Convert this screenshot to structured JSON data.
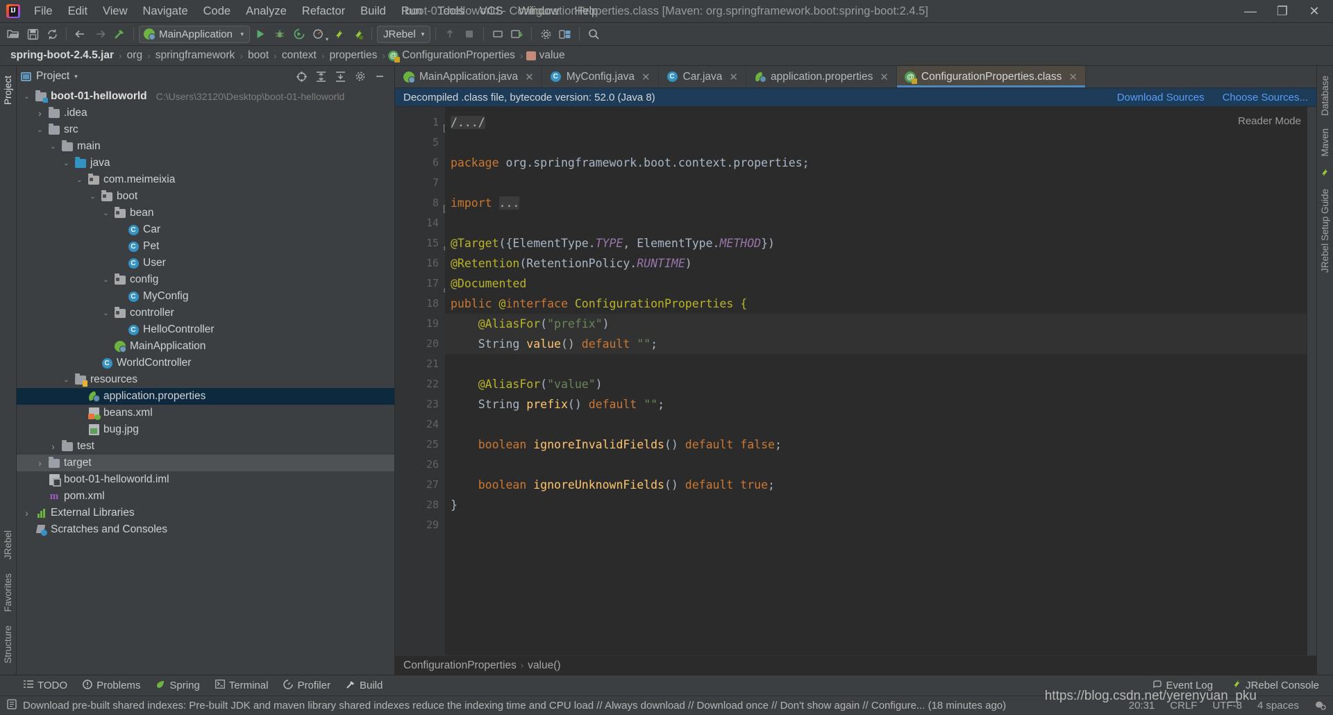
{
  "window": {
    "title": "boot-01-helloworld - ConfigurationProperties.class [Maven: org.springframework.boot:spring-boot:2.4.5]",
    "minimize": "—",
    "maximize": "❐",
    "close": "✕"
  },
  "menu": [
    "File",
    "Edit",
    "View",
    "Navigate",
    "Code",
    "Analyze",
    "Refactor",
    "Build",
    "Run",
    "Tools",
    "VCS",
    "Window",
    "Help"
  ],
  "toolbar": {
    "run_config": "MainApplication",
    "jrebel_selector": "JRebel",
    "caret": "▾"
  },
  "breadcrumb": {
    "items": [
      "spring-boot-2.4.5.jar",
      "org",
      "springframework",
      "boot",
      "context",
      "properties",
      "ConfigurationProperties",
      "value"
    ],
    "separator": "›"
  },
  "project_panel": {
    "title": "Project",
    "caret": "▾",
    "tree": [
      {
        "label": "boot-01-helloworld",
        "sub": "C:\\Users\\32120\\Desktop\\boot-01-helloworld",
        "depth": 0,
        "arrow": "v",
        "icon": "module-folder",
        "bold": true
      },
      {
        "label": ".idea",
        "sub": "",
        "depth": 1,
        "arrow": ">",
        "icon": "folder"
      },
      {
        "label": "src",
        "sub": "",
        "depth": 1,
        "arrow": "v",
        "icon": "folder"
      },
      {
        "label": "main",
        "sub": "",
        "depth": 2,
        "arrow": "v",
        "icon": "folder"
      },
      {
        "label": "java",
        "sub": "",
        "depth": 3,
        "arrow": "v",
        "icon": "source-folder"
      },
      {
        "label": "com.meimeixia",
        "sub": "",
        "depth": 4,
        "arrow": "v",
        "icon": "package"
      },
      {
        "label": "boot",
        "sub": "",
        "depth": 5,
        "arrow": "v",
        "icon": "package"
      },
      {
        "label": "bean",
        "sub": "",
        "depth": 6,
        "arrow": "v",
        "icon": "package"
      },
      {
        "label": "Car",
        "sub": "",
        "depth": 7,
        "arrow": "",
        "icon": "class"
      },
      {
        "label": "Pet",
        "sub": "",
        "depth": 7,
        "arrow": "",
        "icon": "class"
      },
      {
        "label": "User",
        "sub": "",
        "depth": 7,
        "arrow": "",
        "icon": "class"
      },
      {
        "label": "config",
        "sub": "",
        "depth": 6,
        "arrow": "v",
        "icon": "package"
      },
      {
        "label": "MyConfig",
        "sub": "",
        "depth": 7,
        "arrow": "",
        "icon": "class"
      },
      {
        "label": "controller",
        "sub": "",
        "depth": 6,
        "arrow": "v",
        "icon": "package"
      },
      {
        "label": "HelloController",
        "sub": "",
        "depth": 7,
        "arrow": "",
        "icon": "class"
      },
      {
        "label": "MainApplication",
        "sub": "",
        "depth": 6,
        "arrow": "",
        "icon": "springboot-class"
      },
      {
        "label": "WorldController",
        "sub": "",
        "depth": 5,
        "arrow": "",
        "icon": "class"
      },
      {
        "label": "resources",
        "sub": "",
        "depth": 3,
        "arrow": "v",
        "icon": "resources-folder"
      },
      {
        "label": "application.properties",
        "sub": "",
        "depth": 4,
        "arrow": "",
        "icon": "spring-properties",
        "selected": true
      },
      {
        "label": "beans.xml",
        "sub": "",
        "depth": 4,
        "arrow": "",
        "icon": "spring-xml"
      },
      {
        "label": "bug.jpg",
        "sub": "",
        "depth": 4,
        "arrow": "",
        "icon": "image"
      },
      {
        "label": "test",
        "sub": "",
        "depth": 2,
        "arrow": ">",
        "icon": "folder"
      },
      {
        "label": "target",
        "sub": "",
        "depth": 1,
        "arrow": ">",
        "icon": "folder",
        "hovered": true
      },
      {
        "label": "boot-01-helloworld.iml",
        "sub": "",
        "depth": 1,
        "arrow": "",
        "icon": "iml"
      },
      {
        "label": "pom.xml",
        "sub": "",
        "depth": 1,
        "arrow": "",
        "icon": "maven"
      },
      {
        "label": "External Libraries",
        "sub": "",
        "depth": 0,
        "arrow": ">",
        "icon": "libraries"
      },
      {
        "label": "Scratches and Consoles",
        "sub": "",
        "depth": 0,
        "arrow": "",
        "icon": "scratches"
      }
    ]
  },
  "left_strip": {
    "tabs": [
      "Project",
      "Structure",
      "Favorites",
      "JRebel"
    ]
  },
  "right_strip": {
    "tabs": [
      "Database",
      "Maven",
      "JRebel Setup Guide"
    ]
  },
  "editor": {
    "tabs": [
      {
        "label": "MainApplication.java",
        "icon": "springboot-class",
        "close": "✕",
        "active": false
      },
      {
        "label": "MyConfig.java",
        "icon": "class",
        "close": "✕",
        "active": false
      },
      {
        "label": "Car.java",
        "icon": "class",
        "close": "✕",
        "active": false
      },
      {
        "label": "application.properties",
        "icon": "spring-properties",
        "close": "✕",
        "active": false
      },
      {
        "label": "ConfigurationProperties.class",
        "icon": "annotation-locked",
        "close": "✕",
        "active": true
      }
    ],
    "banner": {
      "message": "Decompiled .class file, bytecode version: 52.0 (Java 8)",
      "download_sources": "Download Sources",
      "choose_sources": "Choose Sources..."
    },
    "reader_mode": "Reader Mode",
    "line_numbers": [
      "1",
      "5",
      "6",
      "7",
      "8",
      "14",
      "15",
      "16",
      "17",
      "18",
      "19",
      "20",
      "21",
      "22",
      "23",
      "24",
      "25",
      "26",
      "27",
      "28",
      "29"
    ],
    "code_lines": [
      "/.../",
      "",
      "package org.springframework.boot.context.properties;",
      "",
      "import ...",
      "",
      "@Target({ElementType.TYPE, ElementType.METHOD})",
      "@Retention(RetentionPolicy.RUNTIME)",
      "@Documented",
      "public @interface ConfigurationProperties {",
      "    @AliasFor(\"prefix\")",
      "    String value() default \"\";",
      "",
      "    @AliasFor(\"value\")",
      "    String prefix() default \"\";",
      "",
      "    boolean ignoreInvalidFields() default false;",
      "",
      "    boolean ignoreUnknownFields() default true;",
      "}",
      ""
    ],
    "bottom_breadcrumb": {
      "class": "ConfigurationProperties",
      "member": "value()",
      "separator": "›"
    }
  },
  "tool_window_bar": {
    "left": [
      "TODO",
      "Problems",
      "Spring",
      "Terminal",
      "Profiler",
      "Build"
    ],
    "right": [
      "Event Log",
      "JRebel Console"
    ]
  },
  "status_bar": {
    "message": "Download pre-built shared indexes: Pre-built JDK and maven library shared indexes reduce the indexing time and CPU load // Always download // Download once // Don't show again // Configure... (18 minutes ago)",
    "position": "20:31",
    "line_sep": "CRLF",
    "encoding": "UTF-8",
    "indent": "4 spaces"
  },
  "watermark": "https://blog.csdn.net/yerenyuan_pku",
  "colors": {
    "accent": "#4a88c7",
    "selection": "#0d293e",
    "banner_bg": "#1d3c5a",
    "keyword": "#cc7832",
    "annotation": "#bbb529",
    "string": "#6a8759",
    "static_italic": "#9876aa",
    "method": "#ffc66d",
    "plain": "#a9b7c6"
  }
}
